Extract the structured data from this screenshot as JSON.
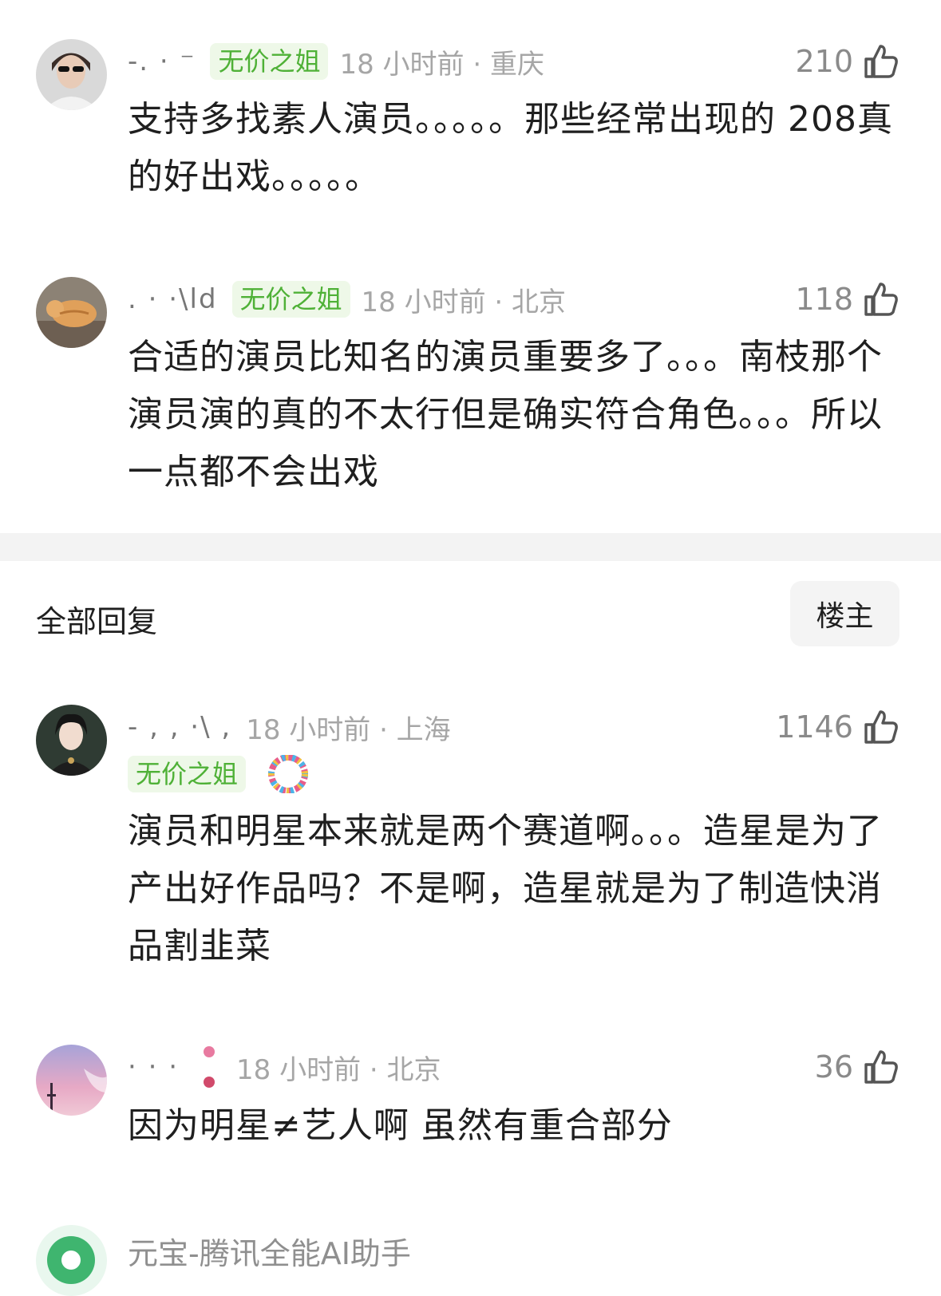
{
  "comments": [
    {
      "username": "-. ·        ⁻",
      "badge": "无价之姐",
      "time_location": "18 小时前 · 重庆",
      "likes": "210",
      "text": "支持多找素人演员。。。。。那些经常出现的 208真的好出戏。。。。。"
    },
    {
      "username": ".          ·         ·\\ld",
      "badge": "无价之姐",
      "time_location": "18 小时前 · 北京",
      "likes": "118",
      "text": "合适的演员比知名的演员重要多了。。。南枝那个演员演的真的不太行但是确实符合角色。。。所以一点都不会出戏"
    }
  ],
  "section": {
    "title": "全部回复",
    "owner_button": "楼主"
  },
  "replies": [
    {
      "username": "- , ,              ·\\ ,",
      "badge": "无价之姐",
      "time_location": "18 小时前 · 上海",
      "likes": "1146",
      "text": "演员和明星本来就是两个赛道啊。。。造星是为了产出好作品吗？不是啊，造星就是为了制造快消品割韭菜"
    },
    {
      "username": "·   ·   ·          ",
      "time_location": "18 小时前 · 北京",
      "likes": "36",
      "text": "因为明星≠艺人啊 虽然有重合部分"
    }
  ],
  "next_item": {
    "name": "元宝-腾讯全能AI助手"
  },
  "icons": {
    "like": "thumbs-up-icon"
  },
  "colors": {
    "badge_text": "#4fb137",
    "badge_bg": "#eef8e8",
    "meta": "#a6a6a6"
  }
}
